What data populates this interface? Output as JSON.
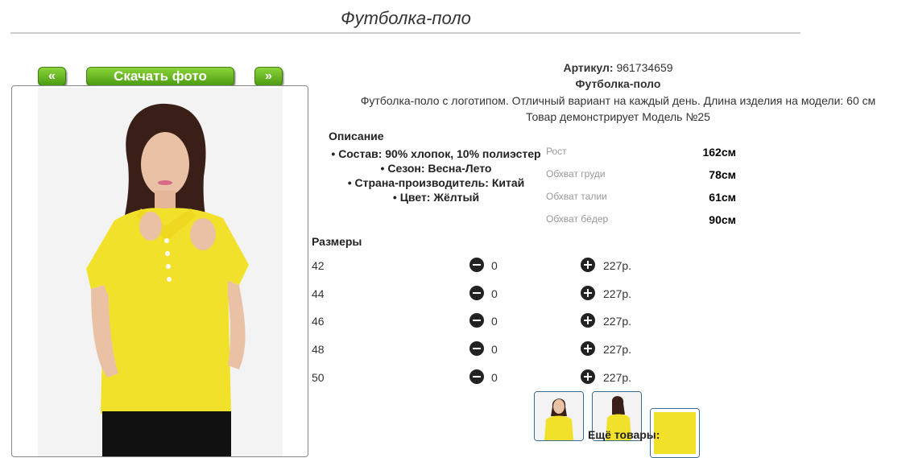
{
  "page_title": "Футболка-поло",
  "nav": {
    "prev_label": "«",
    "download_label": "Скачать фото",
    "next_label": "»"
  },
  "product": {
    "article_label": "Артикул:",
    "article_value": "961734659",
    "name": "Футболка-поло",
    "description": "Футболка-поло с логотипом. Отличный вариант на каждый день. Длина изделия на модели: 60 см",
    "model_note": "Товар демонстрирует Модель №25"
  },
  "description_block": {
    "heading": "Описание",
    "items": [
      "Состав: 90% хлопок, 10% полиэстер",
      "Сезон: Весна-Лето",
      "Страна-производитель: Китай",
      "Цвет: Жёлтый"
    ]
  },
  "measurements": [
    {
      "label": "Рост",
      "value": "162см"
    },
    {
      "label": "Обхват груди",
      "value": "78см"
    },
    {
      "label": "Обхват талии",
      "value": "61см"
    },
    {
      "label": "Обхват бёдер",
      "value": "90см"
    }
  ],
  "sizes": {
    "heading": "Размеры",
    "rows": [
      {
        "size": "42",
        "qty": "0",
        "price": "227р."
      },
      {
        "size": "44",
        "qty": "0",
        "price": "227р."
      },
      {
        "size": "46",
        "qty": "0",
        "price": "227р."
      },
      {
        "size": "48",
        "qty": "0",
        "price": "227р."
      },
      {
        "size": "50",
        "qty": "0",
        "price": "227р."
      }
    ]
  },
  "more_label": "Ещё товары:",
  "icons": {
    "minus": "minus-circle-icon",
    "plus": "plus-circle-icon"
  },
  "colors": {
    "accent_green": "#5aa91a",
    "shirt_yellow": "#f2e12a",
    "thumb_border": "#3a6b8c"
  }
}
